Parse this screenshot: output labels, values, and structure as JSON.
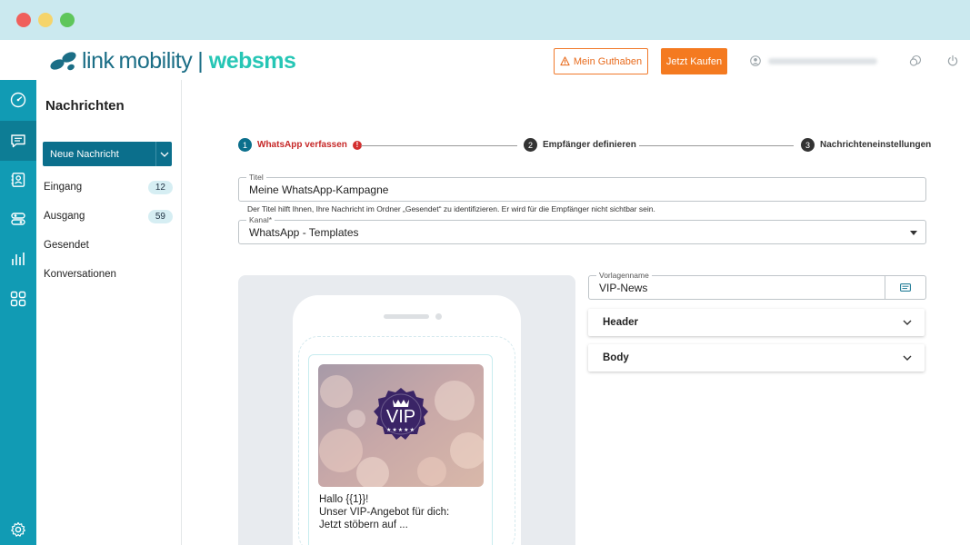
{
  "header": {
    "logo_link": "link",
    "logo_mobility": "mobility",
    "logo_separator": "|",
    "logo_websms": "websms",
    "guthaben_label": "Mein Guthaben",
    "kaufen_label": "Jetzt Kaufen"
  },
  "rail": {
    "icons": [
      "dashboard-icon",
      "messages-icon",
      "contacts-icon",
      "automation-icon",
      "reports-icon",
      "apps-icon",
      "settings-icon"
    ]
  },
  "sidebar": {
    "title": "Nachrichten",
    "new_message": "Neue Nachricht",
    "items": [
      {
        "label": "Eingang",
        "count": "12"
      },
      {
        "label": "Ausgang",
        "count": "59"
      },
      {
        "label": "Gesendet"
      },
      {
        "label": "Konversationen"
      }
    ]
  },
  "stepper": {
    "steps": [
      {
        "num": "1",
        "label": "WhatsApp verfassen",
        "error": "!"
      },
      {
        "num": "2",
        "label": "Empfänger definieren"
      },
      {
        "num": "3",
        "label": "Nachrichteneinstellungen"
      }
    ]
  },
  "form": {
    "title_label": "Titel",
    "title_value": "Meine WhatsApp-Kampagne",
    "title_hint": "Der Titel hilft Ihnen, Ihre Nachricht im Ordner „Gesendet“ zu identifizieren. Er wird für die Empfänger nicht sichtbar sein.",
    "channel_label": "Kanal*",
    "channel_value": "WhatsApp - Templates",
    "template_label": "Vorlagenname",
    "template_value": "VIP-News"
  },
  "preview": {
    "badge_text": "VIP",
    "badge_stars": "★★★★★",
    "line1": "Hallo {{1}}!",
    "line2": "Unser VIP-Angebot für dich:",
    "line3": "Jetzt stöbern auf ..."
  },
  "accordions": {
    "header": "Header",
    "body": "Body"
  },
  "colors": {
    "rail": "#119bb4",
    "primary": "#0b6f8c",
    "accent_orange": "#f47a20",
    "error_red": "#c62828",
    "badge_purple": "#3a2466"
  }
}
